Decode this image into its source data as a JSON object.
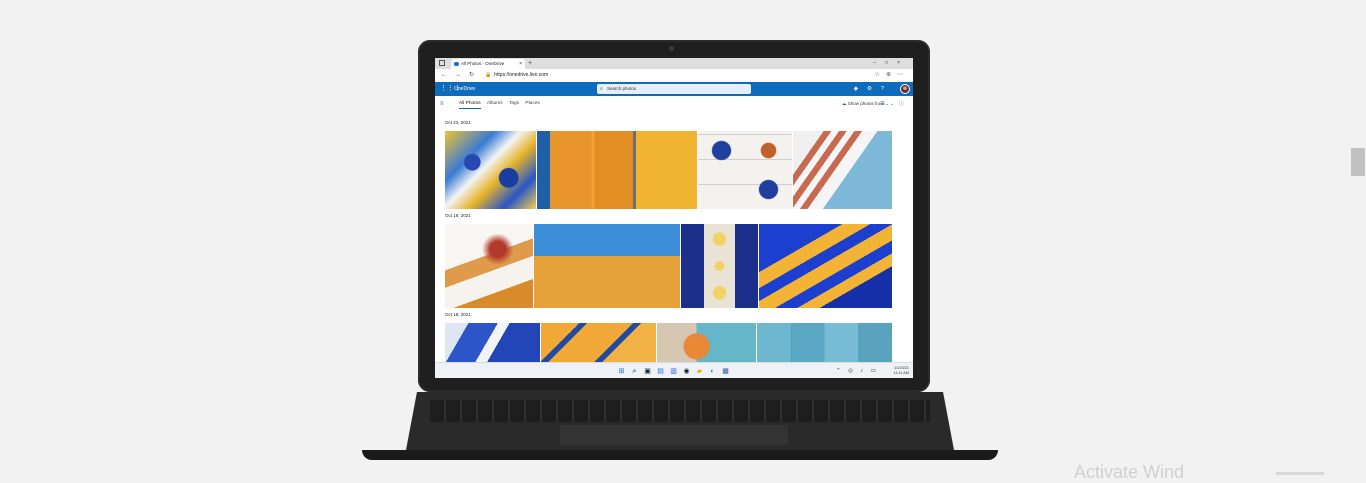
{
  "page": {
    "watermark": "Activate Wind"
  },
  "browser": {
    "tab_title": "All Photos - OneDrive",
    "tab_close": "×",
    "new_tab": "+",
    "window_controls": "–□×",
    "url_lock": "🔒",
    "url": "https://onedrive.live.com",
    "nav_back": "←",
    "nav_forward": "→",
    "nav_refresh": "↻",
    "toolbar_icons": "☆⊕⋯"
  },
  "onedrive": {
    "waffle": "⋮⋮⋮",
    "brand": "OneDrive",
    "search_placeholder": "Search photos",
    "search_icon": "⌕",
    "header_icons": "◆⚙?",
    "hamburger": "≡",
    "tabs": [
      "All Photos",
      "Albums",
      "Tags",
      "Places"
    ],
    "show_photos_from": "Show photos from",
    "show_icon": "☁",
    "view_icons": "☰⌄ⓘ"
  },
  "sections": [
    {
      "date": "Oct 23, 2021"
    },
    {
      "date": "Oct 19, 2021"
    },
    {
      "date": "Oct 18, 2021"
    }
  ],
  "taskbar": {
    "icons": [
      "⊞",
      "⌕",
      "▣",
      "▤",
      "▥",
      "◉",
      "▰",
      "◐",
      "▦"
    ],
    "tray": "⌃ ◎ ♪ ▭",
    "time": "10/23/21",
    "time2": "11:11 AM"
  }
}
